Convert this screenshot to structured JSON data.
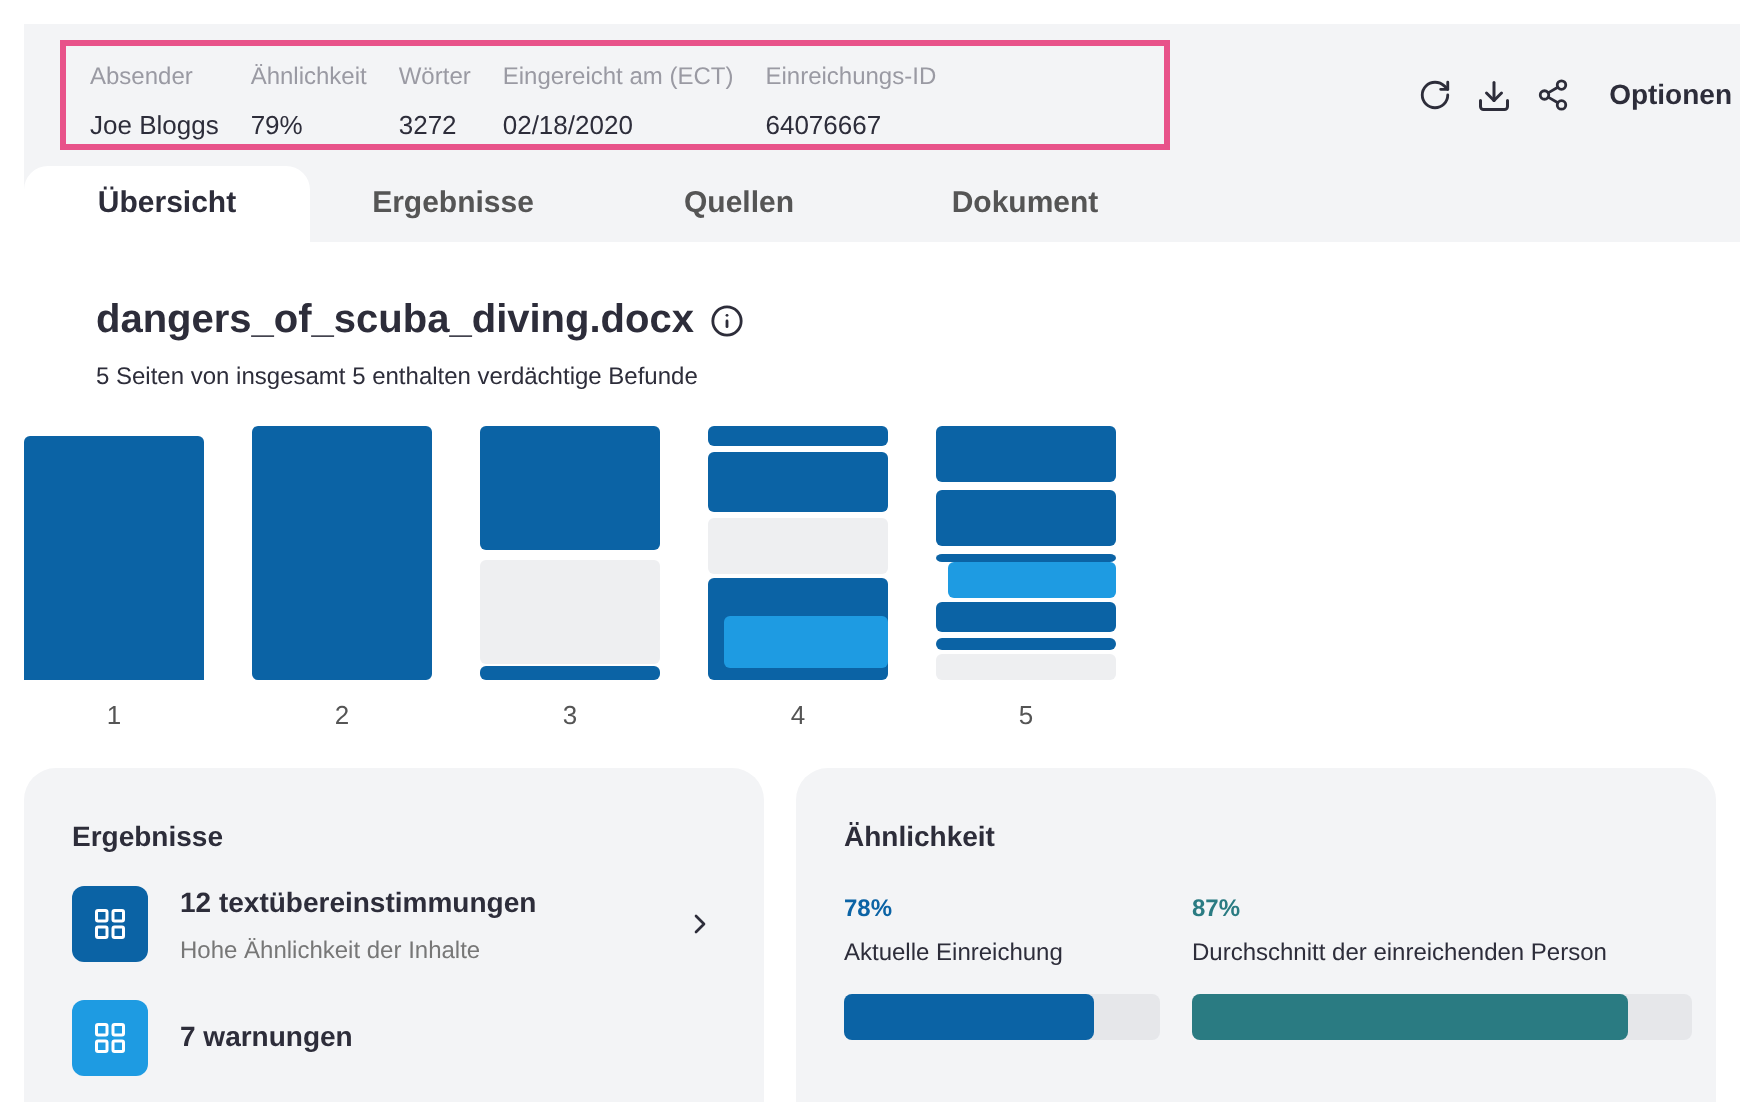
{
  "header": {
    "fields": [
      {
        "label": "Absender",
        "value": "Joe Bloggs"
      },
      {
        "label": "Ähnlichkeit",
        "value": "79%"
      },
      {
        "label": "Wörter",
        "value": "3272"
      },
      {
        "label": "Eingereicht am (ECT)",
        "value": "02/18/2020"
      },
      {
        "label": "Einreichungs-ID",
        "value": "64076667"
      }
    ],
    "options": "Optionen"
  },
  "tabs": [
    {
      "label": "Übersicht",
      "selected": true
    },
    {
      "label": "Ergebnisse",
      "selected": false
    },
    {
      "label": "Quellen",
      "selected": false
    },
    {
      "label": "Dokument",
      "selected": false
    }
  ],
  "document": {
    "title": "dangers_of_scuba_diving.docx",
    "subtitle": "5 Seiten von insgesamt 5 enthalten verdächtige Befunde"
  },
  "pages": [
    {
      "number": "1"
    },
    {
      "number": "2"
    },
    {
      "number": "3"
    },
    {
      "number": "4"
    },
    {
      "number": "5"
    }
  ],
  "results": {
    "title": "Ergebnisse",
    "items": [
      {
        "title": "12 textübereinstimmungen",
        "subtitle": "Hohe Ähnlichkeit der Inhalte",
        "color": "#0b63a5"
      },
      {
        "title": "7 warnungen",
        "color": "#1e9be2"
      }
    ]
  },
  "similarity": {
    "title": "Ähnlichkeit",
    "meters": [
      {
        "value": "78%",
        "label": "Aktuelle Einreichung",
        "level": 0.79,
        "color": "#0b63a5"
      },
      {
        "value": "87%",
        "label": "Durchschnitt der einreichenden Person",
        "level": 0.87,
        "color": "#2a7b82"
      }
    ]
  }
}
